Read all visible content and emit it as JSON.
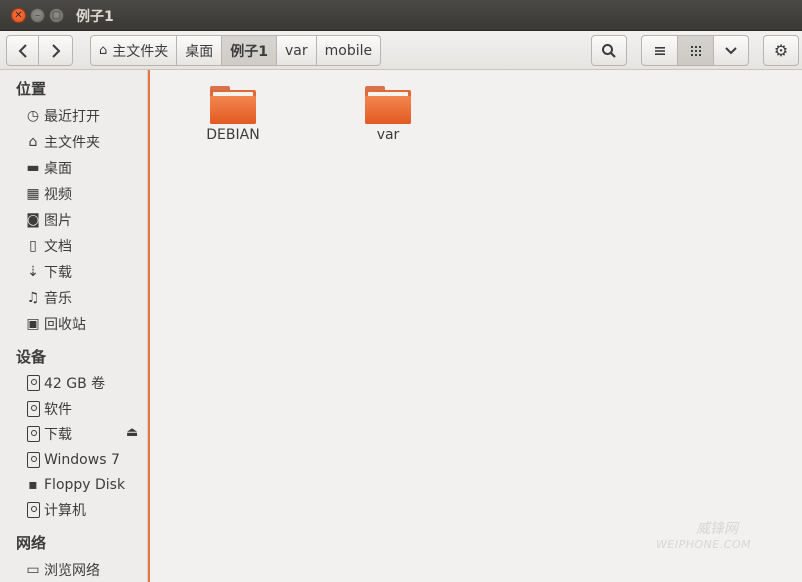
{
  "window": {
    "title": "例子1"
  },
  "toolbar": {
    "breadcrumbs": [
      {
        "label": "主文件夹",
        "icon": "home-icon"
      },
      {
        "label": "桌面"
      },
      {
        "label": "例子1"
      },
      {
        "label": "var"
      },
      {
        "label": "mobile"
      }
    ],
    "active_crumb": "例子1"
  },
  "sidebar": {
    "places_header": "位置",
    "places": [
      {
        "label": "最近打开",
        "icon": "recent-icon"
      },
      {
        "label": "主文件夹",
        "icon": "home-icon"
      },
      {
        "label": "桌面",
        "icon": "desktop-icon"
      },
      {
        "label": "视频",
        "icon": "video-icon"
      },
      {
        "label": "图片",
        "icon": "camera-icon"
      },
      {
        "label": "文档",
        "icon": "document-icon"
      },
      {
        "label": "下载",
        "icon": "download-icon"
      },
      {
        "label": "音乐",
        "icon": "music-icon"
      },
      {
        "label": "回收站",
        "icon": "trash-icon"
      }
    ],
    "devices_header": "设备",
    "devices": [
      {
        "label": "42 GB 卷",
        "icon": "drive-icon"
      },
      {
        "label": "软件",
        "icon": "drive-icon"
      },
      {
        "label": "下载",
        "icon": "drive-icon",
        "eject": true
      },
      {
        "label": "Windows 7",
        "icon": "drive-icon"
      },
      {
        "label": "Floppy Disk",
        "icon": "floppy-icon"
      },
      {
        "label": "计算机",
        "icon": "drive-icon"
      }
    ],
    "network_header": "网络",
    "network": [
      {
        "label": "浏览网络",
        "icon": "network-icon"
      }
    ]
  },
  "content": {
    "files": [
      {
        "name": "DEBIAN",
        "type": "folder"
      },
      {
        "name": "var",
        "type": "folder"
      }
    ]
  },
  "watermark": {
    "text": "威锋网",
    "sub": "WEIPHONE.COM"
  },
  "colors": {
    "accent": "#e9743f",
    "folder": "#e25a22",
    "titlebar": "#3c3b37"
  }
}
